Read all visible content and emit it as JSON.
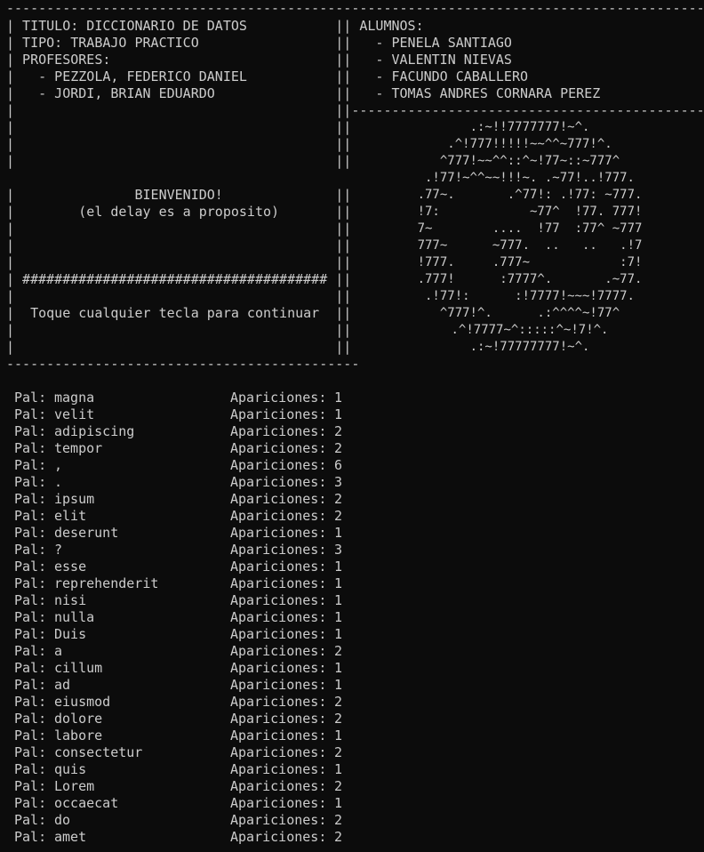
{
  "screen": {
    "lines": [
      "------------------------------------------------------------------------------------------",
      "| TITULO: DICCIONARIO DE DATOS           || ALUMNOS:                                    |",
      "| TIPO: TRABAJO PRACTICO                 ||   - PENELA SANTIAGO                         |",
      "| PROFESORES:                            ||   - VALENTIN NIEVAS                         |",
      "|   - PEZZOLA, FEDERICO DANIEL           ||   - FACUNDO CABALLERO                       |",
      "|   - JORDI, BRIAN EDUARDO               ||   - TOMAS ANDRES CORNARA PEREZ              |",
      "|                                        ||---------------------------------------------",
      "|                                        ||",
      "|                                        ||",
      "|                                        ||",
      "|               BIENVENIDO!              ||",
      "|        (el delay es a proposito)       ||",
      "|                                        ||",
      "|                                        ||",
      "|                                        ||",
      "| ###################################### ||",
      "|                                        ||",
      "|  Toque cualquier tecla para continuar  ||",
      "|                                        ||",
      "|                                        ||",
      "--------------------------------------------"
    ]
  },
  "ascii_art": [
    ".:~!!7777777!~^.",
    ".^!777!!!!!~~^^~777!^.",
    "^777!~~^^::^~!77~::~777^",
    ".!77!~^^~~!!!~. .~77!..!777.",
    ".77~.       .^77!: .!77: ~777.",
    "!7:            ~77^  !77. 777!",
    "7~        ....  !77  :77^ ~777",
    "777~      ~777.  ..   ..   .!7",
    "!777.     .777~            :7!",
    ".777!      :7777^.       .~77.",
    ".!77!:      :!7777!~~~!7777.",
    "^777!^.      .:^^^^~!77^",
    ".^!7777~^:::::^~!7!^.",
    ".:~!77777777!~^."
  ],
  "word_list": {
    "word_label": "Pal:",
    "count_label": "Apariciones:",
    "rows": [
      {
        "word": "magna",
        "count": "1"
      },
      {
        "word": "velit",
        "count": "1"
      },
      {
        "word": "adipiscing",
        "count": "2"
      },
      {
        "word": "tempor",
        "count": "2"
      },
      {
        "word": ",",
        "count": "6"
      },
      {
        "word": ".",
        "count": "3"
      },
      {
        "word": "ipsum",
        "count": "2"
      },
      {
        "word": "elit",
        "count": "2"
      },
      {
        "word": "deserunt",
        "count": "1"
      },
      {
        "word": "?",
        "count": "3"
      },
      {
        "word": "esse",
        "count": "1"
      },
      {
        "word": "reprehenderit",
        "count": "1"
      },
      {
        "word": "nisi",
        "count": "1"
      },
      {
        "word": "nulla",
        "count": "1"
      },
      {
        "word": "Duis",
        "count": "1"
      },
      {
        "word": "a",
        "count": "2"
      },
      {
        "word": "cillum",
        "count": "1"
      },
      {
        "word": "ad",
        "count": "1"
      },
      {
        "word": "eiusmod",
        "count": "2"
      },
      {
        "word": "dolore",
        "count": "2"
      },
      {
        "word": "labore",
        "count": "1"
      },
      {
        "word": "consectetur",
        "count": "2"
      },
      {
        "word": "quis",
        "count": "1"
      },
      {
        "word": "Lorem",
        "count": "2"
      },
      {
        "word": "occaecat",
        "count": "1"
      },
      {
        "word": "do",
        "count": "2"
      },
      {
        "word": "amet",
        "count": "2"
      }
    ]
  }
}
